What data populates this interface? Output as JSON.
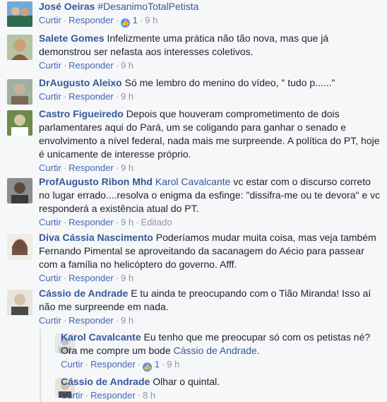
{
  "comments": [
    {
      "name": "José Oeiras",
      "text": "#DesanimoTotalPetista",
      "actions": {
        "like": "Curtir",
        "reply": "Responder",
        "reactions": "1",
        "time": "9 h"
      },
      "avatar_colors": [
        "#2d6a4f",
        "#74a9d6"
      ]
    },
    {
      "name": "Salete Gomes",
      "text": "Infelizmente uma prática não tão nova, mas que já demonstrou ser nefasta aos interesses coletivos.",
      "actions": {
        "like": "Curtir",
        "reply": "Responder",
        "time": "9 h"
      },
      "avatar_colors": [
        "#8a5a3b",
        "#c9a27b"
      ]
    },
    {
      "name": "DrAugusto Aleixo",
      "text": "Só me lembro do menino do vídeo, \" tudo p......\"",
      "actions": {
        "like": "Curtir",
        "reply": "Responder",
        "time": "9 h"
      },
      "avatar_colors": [
        "#7a6a55",
        "#c7b39a"
      ]
    },
    {
      "name": "Castro Figueiredo",
      "text": "Depois que houveram comprometimento de dois parlamentares aqui do Pará, um se coligando para ganhar o senado e envolvimento a nível federal, nada mais me surpreende. A política do PT, hoje é unicamente de interesse próprio.",
      "actions": {
        "like": "Curtir",
        "reply": "Responder",
        "time": "9 h"
      },
      "avatar_colors": [
        "#3b5e2b",
        "#d9c6a3"
      ]
    },
    {
      "name": "ProfAugusto Ribon Mhd",
      "mention": "Karol Cavalcante",
      "text": "vc estar com o discurso correto no lugar errado....resolva o enigma da esfinge: \"dissifra-me ou te devora\" e vc responderá a existência atual do PT.",
      "actions": {
        "like": "Curtir",
        "reply": "Responder",
        "time": "9 h",
        "edited": "Editado"
      },
      "avatar_colors": [
        "#3a3a3a",
        "#8c8c8c"
      ]
    },
    {
      "name": "Diva Cássia Nascimento",
      "text": "Poderíamos mudar muita coisa, mas veja também Fernando Pimental se aproveitando da sacanagem do Aécio para passear com a família no helicóptero do governo. Afff.",
      "actions": {
        "like": "Curtir",
        "reply": "Responder",
        "time": "9 h"
      },
      "avatar_colors": [
        "#5b3b2e",
        "#d8b08c"
      ]
    },
    {
      "name": "Cássio de Andrade",
      "text": "E tu ainda te preocupando com o Tião Miranda! Isso aí não me surpreende em nada.",
      "actions": {
        "like": "Curtir",
        "reply": "Responder",
        "time": "9 h"
      },
      "avatar_colors": [
        "#4a4a4a",
        "#d3c2ab"
      ]
    }
  ],
  "replies": [
    {
      "name": "Karol Cavalcante",
      "text_before": "Eu tenho que me preocupar só com os petistas né? Ora me compre um bode",
      "mention": "Cássio de Andrade",
      "text_after": ".",
      "actions": {
        "like": "Curtir",
        "reply": "Responder",
        "reactions": "1",
        "time": "9 h"
      },
      "avatar_colors": [
        "#bfbfbf",
        "#e6e6e6"
      ]
    },
    {
      "name": "Cássio de Andrade",
      "text": "Olhar o quintal.",
      "actions": {
        "like": "Curtir",
        "reply": "Responder",
        "time": "8 h"
      },
      "avatar_colors": [
        "#4a4a4a",
        "#d3c2ab"
      ]
    }
  ],
  "icons": {
    "like_reaction": "thumbs-up-icon",
    "separator": "·"
  },
  "colors": {
    "name": "#365899",
    "action": "#4267b2",
    "meta": "#90949c",
    "reaction": "#5890ff"
  }
}
